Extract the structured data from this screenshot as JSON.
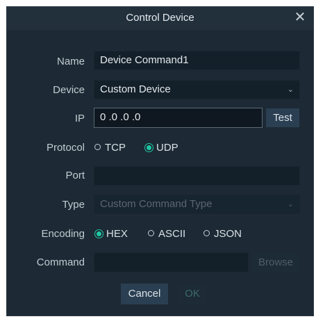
{
  "dialog": {
    "title": "Control Device"
  },
  "fields": {
    "name": {
      "label": "Name",
      "value": "Device Command1"
    },
    "device": {
      "label": "Device",
      "value": "Custom Device"
    },
    "ip": {
      "label": "IP",
      "value": "0 .0 .0 .0",
      "test_label": "Test"
    },
    "protocol": {
      "label": "Protocol",
      "options": [
        "TCP",
        "UDP"
      ],
      "selected": "UDP"
    },
    "port": {
      "label": "Port",
      "value": ""
    },
    "type": {
      "label": "Type",
      "value": "Custom Command Type"
    },
    "encoding": {
      "label": "Encoding",
      "options": [
        "HEX",
        "ASCII",
        "JSON"
      ],
      "selected": "HEX"
    },
    "command": {
      "label": "Command",
      "value": "",
      "browse_label": "Browse"
    }
  },
  "buttons": {
    "cancel": "Cancel",
    "ok": "OK"
  },
  "colors": {
    "accent": "#1fc8a5",
    "background": "#1d2a35",
    "titlebar": "#22303c"
  },
  "icons": {
    "close": "close-icon",
    "dropdown": "chevron-down-icon"
  }
}
